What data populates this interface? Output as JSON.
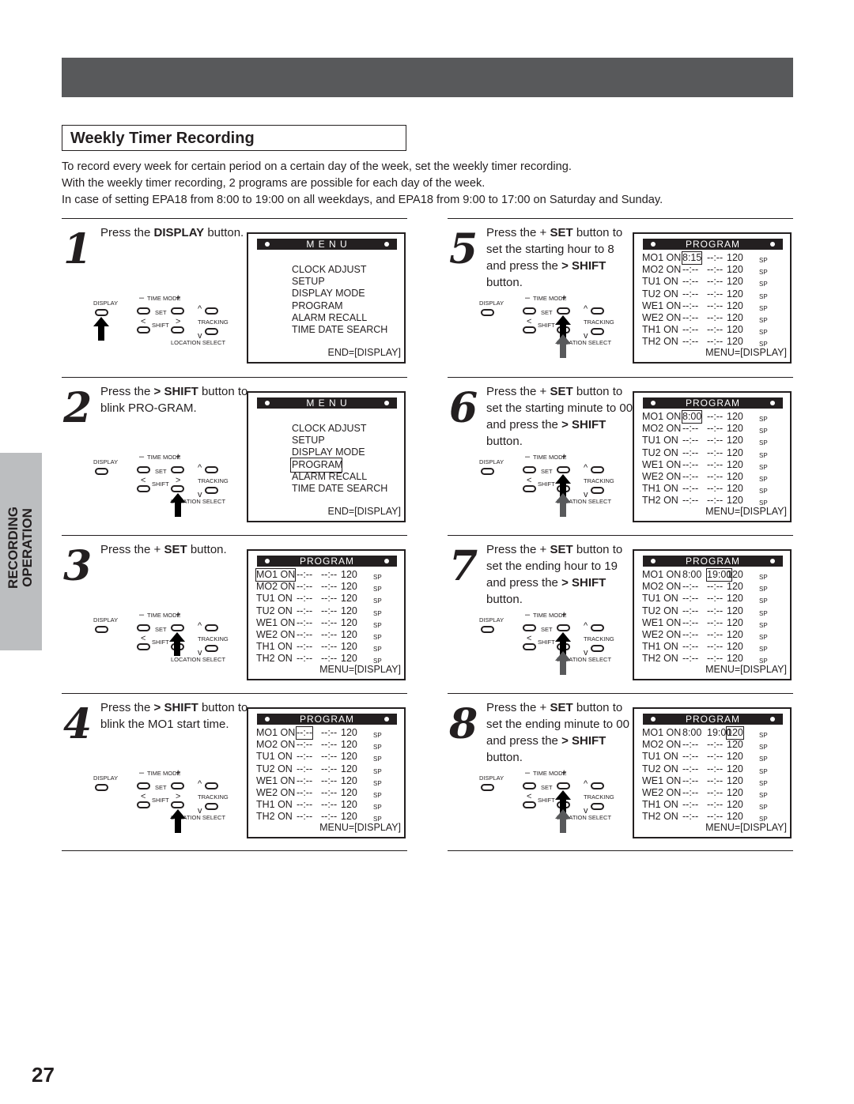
{
  "page": {
    "section_title": "Weekly Timer Recording",
    "intro_lines": [
      "To record every week for certain period on a certain day of the week, set the weekly timer recording.",
      "With the weekly timer recording, 2 programs are possible for each day of the week.",
      "In case of setting EPA18 from 8:00 to 19:00 on all weekdays, and EPA18 from 9:00 to 17:00 on Saturday and Sunday."
    ],
    "side_tab": [
      "RECORDING",
      "OPERATION"
    ],
    "page_number": "27"
  },
  "remote_labels": {
    "display": "DISPLAY",
    "time_mode": "TIME MODE",
    "set": "SET",
    "shift": "SHIFT",
    "tracking": "TRACKING",
    "location_select": "LOCATION SELECT",
    "minus": "–",
    "plus": "+",
    "lt": "<",
    "gt": ">"
  },
  "menu_screen": {
    "header": "M E N U",
    "items": [
      "CLOCK ADJUST",
      "SETUP",
      "DISPLAY MODE",
      "PROGRAM",
      "ALARM RECALL",
      "TIME DATE SEARCH"
    ],
    "footer": "END=[DISPLAY]"
  },
  "program_screen": {
    "header": "PROGRAM",
    "footer": "MENU=[DISPLAY]",
    "sp": "SP"
  },
  "steps": [
    {
      "number": "1",
      "instruction_parts": [
        "Press the ",
        "DISPLAY",
        " button."
      ],
      "pressed_button": "display",
      "screen": "menu",
      "highlight": null
    },
    {
      "number": "2",
      "instruction_parts": [
        "Press the ",
        "> SHIFT",
        " button to blink PRO-GRAM."
      ],
      "pressed_button": "shift-right",
      "screen": "menu",
      "highlight": "PROGRAM"
    },
    {
      "number": "3",
      "instruction_parts": [
        "Press the + ",
        "SET",
        " button."
      ],
      "pressed_button": "set-plus",
      "screen": "program",
      "rows": [
        {
          "day": "MO1 ON",
          "start": "--:--",
          "end": "--:--",
          "len": "120",
          "hl": "on"
        },
        {
          "day": "MO2 ON",
          "start": "--:--",
          "end": "--:--",
          "len": "120"
        },
        {
          "day": "TU1 ON",
          "start": "--:--",
          "end": "--:--",
          "len": "120"
        },
        {
          "day": "TU2 ON",
          "start": "--:--",
          "end": "--:--",
          "len": "120"
        },
        {
          "day": "WE1 ON",
          "start": "--:--",
          "end": "--:--",
          "len": "120"
        },
        {
          "day": "WE2 ON",
          "start": "--:--",
          "end": "--:--",
          "len": "120"
        },
        {
          "day": "TH1 ON",
          "start": "--:--",
          "end": "--:--",
          "len": "120"
        },
        {
          "day": "TH2 ON",
          "start": "--:--",
          "end": "--:--",
          "len": "120"
        }
      ]
    },
    {
      "number": "4",
      "instruction_parts": [
        "Press the ",
        "> SHIFT",
        " button to blink the MO1 start time."
      ],
      "pressed_button": "shift-right",
      "screen": "program",
      "rows": [
        {
          "day": "MO1 ON",
          "start": "--:--",
          "end": "--:--",
          "len": "120",
          "hl": "start"
        },
        {
          "day": "MO2 ON",
          "start": "--:--",
          "end": "--:--",
          "len": "120"
        },
        {
          "day": "TU1 ON",
          "start": "--:--",
          "end": "--:--",
          "len": "120"
        },
        {
          "day": "TU2 ON",
          "start": "--:--",
          "end": "--:--",
          "len": "120"
        },
        {
          "day": "WE1 ON",
          "start": "--:--",
          "end": "--:--",
          "len": "120"
        },
        {
          "day": "WE2 ON",
          "start": "--:--",
          "end": "--:--",
          "len": "120"
        },
        {
          "day": "TH1 ON",
          "start": "--:--",
          "end": "--:--",
          "len": "120"
        },
        {
          "day": "TH2 ON",
          "start": "--:--",
          "end": "--:--",
          "len": "120"
        }
      ]
    },
    {
      "number": "5",
      "instruction_parts": [
        "Press the + ",
        "SET",
        " button to set the starting hour to 8 and press the ",
        "> SHIFT",
        " button."
      ],
      "pressed_button": "set-plus+shift-right",
      "screen": "program",
      "rows": [
        {
          "day": "MO1 ON",
          "start": "8:15",
          "end": "--:--",
          "len": "120",
          "hl": "start"
        },
        {
          "day": "MO2 ON",
          "start": "--:--",
          "end": "--:--",
          "len": "120"
        },
        {
          "day": "TU1 ON",
          "start": "--:--",
          "end": "--:--",
          "len": "120"
        },
        {
          "day": "TU2 ON",
          "start": "--:--",
          "end": "--:--",
          "len": "120"
        },
        {
          "day": "WE1 ON",
          "start": "--:--",
          "end": "--:--",
          "len": "120"
        },
        {
          "day": "WE2 ON",
          "start": "--:--",
          "end": "--:--",
          "len": "120"
        },
        {
          "day": "TH1 ON",
          "start": "--:--",
          "end": "--:--",
          "len": "120"
        },
        {
          "day": "TH2 ON",
          "start": "--:--",
          "end": "--:--",
          "len": "120"
        }
      ]
    },
    {
      "number": "6",
      "instruction_parts": [
        "Press the + ",
        "SET",
        " button to set the starting minute to 00 and press the ",
        ">",
        " ",
        "SHIFT",
        " button."
      ],
      "pressed_button": "set-plus+shift-right",
      "screen": "program",
      "rows": [
        {
          "day": "MO1 ON",
          "start": "8:00",
          "end": "--:--",
          "len": "120",
          "hl": "start"
        },
        {
          "day": "MO2 ON",
          "start": "--:--",
          "end": "--:--",
          "len": "120"
        },
        {
          "day": "TU1 ON",
          "start": "--:--",
          "end": "--:--",
          "len": "120"
        },
        {
          "day": "TU2 ON",
          "start": "--:--",
          "end": "--:--",
          "len": "120"
        },
        {
          "day": "WE1 ON",
          "start": "--:--",
          "end": "--:--",
          "len": "120"
        },
        {
          "day": "WE2 ON",
          "start": "--:--",
          "end": "--:--",
          "len": "120"
        },
        {
          "day": "TH1 ON",
          "start": "--:--",
          "end": "--:--",
          "len": "120"
        },
        {
          "day": "TH2 ON",
          "start": "--:--",
          "end": "--:--",
          "len": "120"
        }
      ]
    },
    {
      "number": "7",
      "instruction_parts": [
        "Press the + ",
        "SET",
        " button to set the ending hour to 19 and press the ",
        ">",
        " ",
        "SHIFT",
        " button."
      ],
      "pressed_button": "set-plus+shift-right",
      "screen": "program",
      "rows": [
        {
          "day": "MO1 ON",
          "start": "8:00",
          "end": "19:00",
          "len": "120",
          "hl": "end"
        },
        {
          "day": "MO2 ON",
          "start": "--:--",
          "end": "--:--",
          "len": "120"
        },
        {
          "day": "TU1 ON",
          "start": "--:--",
          "end": "--:--",
          "len": "120"
        },
        {
          "day": "TU2 ON",
          "start": "--:--",
          "end": "--:--",
          "len": "120"
        },
        {
          "day": "WE1 ON",
          "start": "--:--",
          "end": "--:--",
          "len": "120"
        },
        {
          "day": "WE2 ON",
          "start": "--:--",
          "end": "--:--",
          "len": "120"
        },
        {
          "day": "TH1 ON",
          "start": "--:--",
          "end": "--:--",
          "len": "120"
        },
        {
          "day": "TH2 ON",
          "start": "--:--",
          "end": "--:--",
          "len": "120"
        }
      ]
    },
    {
      "number": "8",
      "instruction_parts": [
        "Press the + ",
        "SET",
        " button to set the ending minute to 00 and press the ",
        ">",
        " ",
        "SHIFT",
        " button."
      ],
      "pressed_button": "set-plus+shift-right",
      "screen": "program",
      "rows": [
        {
          "day": "MO1 ON",
          "start": "8:00",
          "end": "19:00",
          "len": "120",
          "hl": "len"
        },
        {
          "day": "MO2 ON",
          "start": "--:--",
          "end": "--:--",
          "len": "120"
        },
        {
          "day": "TU1 ON",
          "start": "--:--",
          "end": "--:--",
          "len": "120"
        },
        {
          "day": "TU2 ON",
          "start": "--:--",
          "end": "--:--",
          "len": "120"
        },
        {
          "day": "WE1 ON",
          "start": "--:--",
          "end": "--:--",
          "len": "120"
        },
        {
          "day": "WE2 ON",
          "start": "--:--",
          "end": "--:--",
          "len": "120"
        },
        {
          "day": "TH1 ON",
          "start": "--:--",
          "end": "--:--",
          "len": "120"
        },
        {
          "day": "TH2 ON",
          "start": "--:--",
          "end": "--:--",
          "len": "120"
        }
      ]
    }
  ]
}
